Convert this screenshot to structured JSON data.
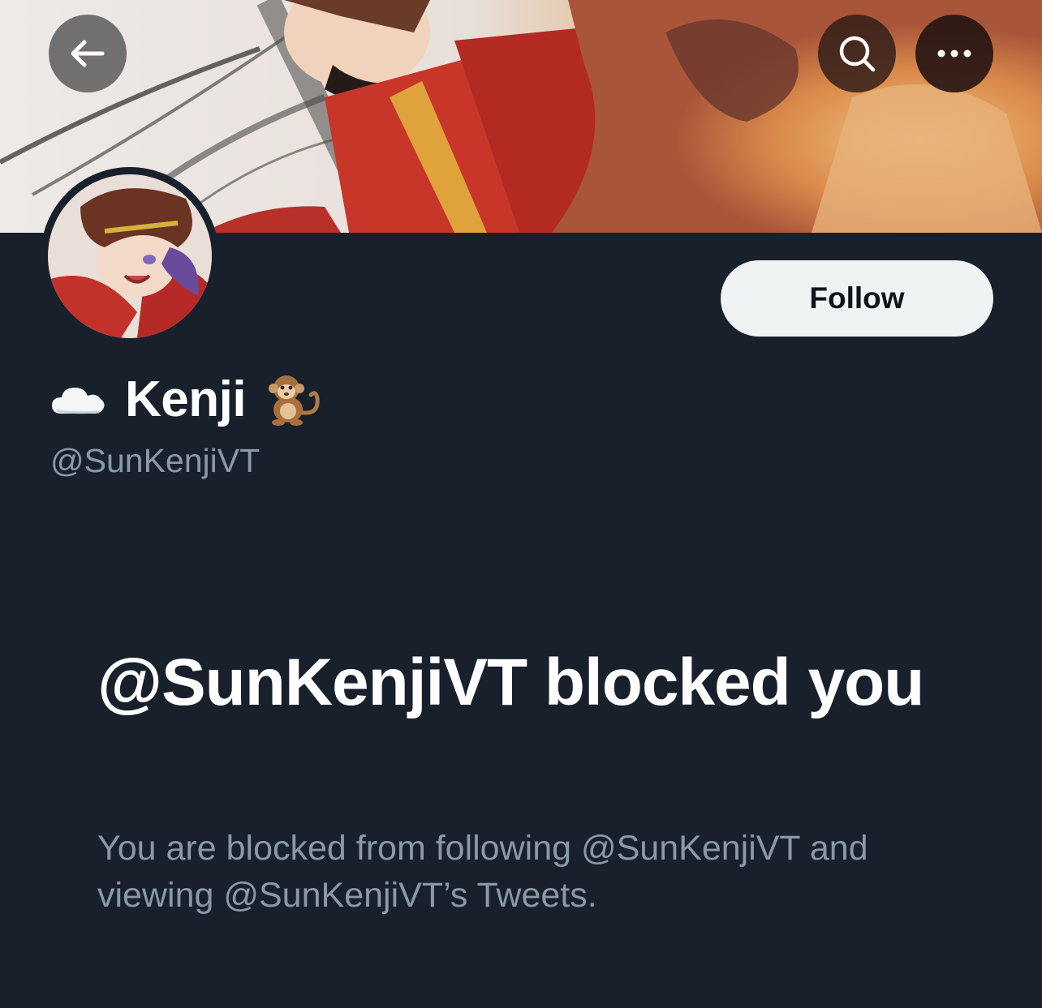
{
  "profile": {
    "name": "Kenji",
    "name_prefix_icon": "cloud-icon",
    "name_suffix_icon": "monkey-icon",
    "handle": "@SunKenjiVT",
    "follow_label": "Follow"
  },
  "nav": {
    "back_icon": "back-arrow-icon",
    "search_icon": "search-icon",
    "more_icon": "more-icon"
  },
  "blocked": {
    "title": "@SunKenjiVT blocked you",
    "description": "You are blocked from following @SunKenjiVT and viewing @SunKenjiVT’s Tweets."
  },
  "colors": {
    "background": "#17202b",
    "follow_bg": "#eff3f4",
    "secondary_text": "#8b98a5"
  }
}
